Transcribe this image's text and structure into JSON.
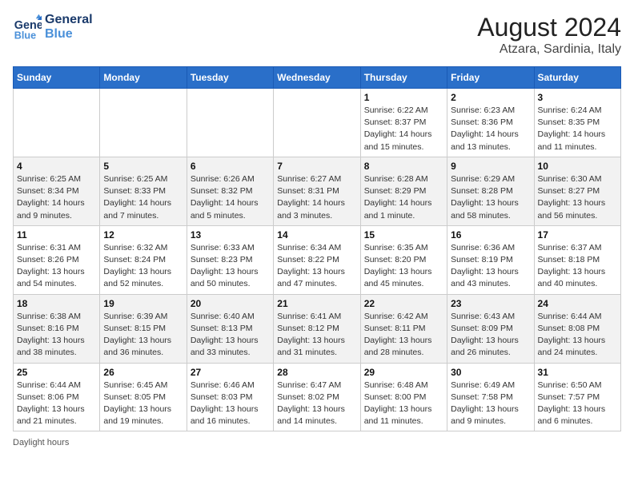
{
  "header": {
    "logo_line1": "General",
    "logo_line2": "Blue",
    "month_year": "August 2024",
    "location": "Atzara, Sardinia, Italy"
  },
  "days_of_week": [
    "Sunday",
    "Monday",
    "Tuesday",
    "Wednesday",
    "Thursday",
    "Friday",
    "Saturday"
  ],
  "weeks": [
    [
      {
        "day": "",
        "info": ""
      },
      {
        "day": "",
        "info": ""
      },
      {
        "day": "",
        "info": ""
      },
      {
        "day": "",
        "info": ""
      },
      {
        "day": "1",
        "info": "Sunrise: 6:22 AM\nSunset: 8:37 PM\nDaylight: 14 hours\nand 15 minutes."
      },
      {
        "day": "2",
        "info": "Sunrise: 6:23 AM\nSunset: 8:36 PM\nDaylight: 14 hours\nand 13 minutes."
      },
      {
        "day": "3",
        "info": "Sunrise: 6:24 AM\nSunset: 8:35 PM\nDaylight: 14 hours\nand 11 minutes."
      }
    ],
    [
      {
        "day": "4",
        "info": "Sunrise: 6:25 AM\nSunset: 8:34 PM\nDaylight: 14 hours\nand 9 minutes."
      },
      {
        "day": "5",
        "info": "Sunrise: 6:25 AM\nSunset: 8:33 PM\nDaylight: 14 hours\nand 7 minutes."
      },
      {
        "day": "6",
        "info": "Sunrise: 6:26 AM\nSunset: 8:32 PM\nDaylight: 14 hours\nand 5 minutes."
      },
      {
        "day": "7",
        "info": "Sunrise: 6:27 AM\nSunset: 8:31 PM\nDaylight: 14 hours\nand 3 minutes."
      },
      {
        "day": "8",
        "info": "Sunrise: 6:28 AM\nSunset: 8:29 PM\nDaylight: 14 hours\nand 1 minute."
      },
      {
        "day": "9",
        "info": "Sunrise: 6:29 AM\nSunset: 8:28 PM\nDaylight: 13 hours\nand 58 minutes."
      },
      {
        "day": "10",
        "info": "Sunrise: 6:30 AM\nSunset: 8:27 PM\nDaylight: 13 hours\nand 56 minutes."
      }
    ],
    [
      {
        "day": "11",
        "info": "Sunrise: 6:31 AM\nSunset: 8:26 PM\nDaylight: 13 hours\nand 54 minutes."
      },
      {
        "day": "12",
        "info": "Sunrise: 6:32 AM\nSunset: 8:24 PM\nDaylight: 13 hours\nand 52 minutes."
      },
      {
        "day": "13",
        "info": "Sunrise: 6:33 AM\nSunset: 8:23 PM\nDaylight: 13 hours\nand 50 minutes."
      },
      {
        "day": "14",
        "info": "Sunrise: 6:34 AM\nSunset: 8:22 PM\nDaylight: 13 hours\nand 47 minutes."
      },
      {
        "day": "15",
        "info": "Sunrise: 6:35 AM\nSunset: 8:20 PM\nDaylight: 13 hours\nand 45 minutes."
      },
      {
        "day": "16",
        "info": "Sunrise: 6:36 AM\nSunset: 8:19 PM\nDaylight: 13 hours\nand 43 minutes."
      },
      {
        "day": "17",
        "info": "Sunrise: 6:37 AM\nSunset: 8:18 PM\nDaylight: 13 hours\nand 40 minutes."
      }
    ],
    [
      {
        "day": "18",
        "info": "Sunrise: 6:38 AM\nSunset: 8:16 PM\nDaylight: 13 hours\nand 38 minutes."
      },
      {
        "day": "19",
        "info": "Sunrise: 6:39 AM\nSunset: 8:15 PM\nDaylight: 13 hours\nand 36 minutes."
      },
      {
        "day": "20",
        "info": "Sunrise: 6:40 AM\nSunset: 8:13 PM\nDaylight: 13 hours\nand 33 minutes."
      },
      {
        "day": "21",
        "info": "Sunrise: 6:41 AM\nSunset: 8:12 PM\nDaylight: 13 hours\nand 31 minutes."
      },
      {
        "day": "22",
        "info": "Sunrise: 6:42 AM\nSunset: 8:11 PM\nDaylight: 13 hours\nand 28 minutes."
      },
      {
        "day": "23",
        "info": "Sunrise: 6:43 AM\nSunset: 8:09 PM\nDaylight: 13 hours\nand 26 minutes."
      },
      {
        "day": "24",
        "info": "Sunrise: 6:44 AM\nSunset: 8:08 PM\nDaylight: 13 hours\nand 24 minutes."
      }
    ],
    [
      {
        "day": "25",
        "info": "Sunrise: 6:44 AM\nSunset: 8:06 PM\nDaylight: 13 hours\nand 21 minutes."
      },
      {
        "day": "26",
        "info": "Sunrise: 6:45 AM\nSunset: 8:05 PM\nDaylight: 13 hours\nand 19 minutes."
      },
      {
        "day": "27",
        "info": "Sunrise: 6:46 AM\nSunset: 8:03 PM\nDaylight: 13 hours\nand 16 minutes."
      },
      {
        "day": "28",
        "info": "Sunrise: 6:47 AM\nSunset: 8:02 PM\nDaylight: 13 hours\nand 14 minutes."
      },
      {
        "day": "29",
        "info": "Sunrise: 6:48 AM\nSunset: 8:00 PM\nDaylight: 13 hours\nand 11 minutes."
      },
      {
        "day": "30",
        "info": "Sunrise: 6:49 AM\nSunset: 7:58 PM\nDaylight: 13 hours\nand 9 minutes."
      },
      {
        "day": "31",
        "info": "Sunrise: 6:50 AM\nSunset: 7:57 PM\nDaylight: 13 hours\nand 6 minutes."
      }
    ]
  ],
  "footer": {
    "note": "Daylight hours"
  }
}
